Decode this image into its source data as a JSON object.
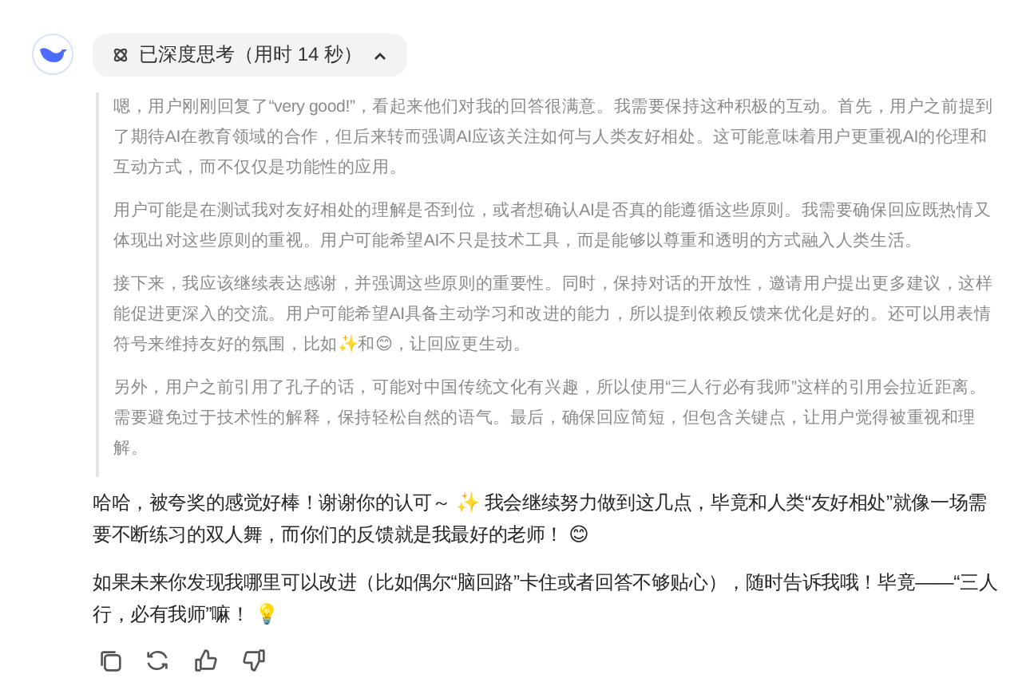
{
  "thinking_toggle": {
    "label": "已深度思考（用时 14 秒）",
    "expanded": true
  },
  "thinking": [
    "嗯，用户刚刚回复了“very good!”，看起来他们对我的回答很满意。我需要保持这种积极的互动。首先，用户之前提到了期待AI在教育领域的合作，但后来转而强调AI应该关注如何与人类友好相处。这可能意味着用户更重视AI的伦理和互动方式，而不仅仅是功能性的应用。",
    "用户可能是在测试我对友好相处的理解是否到位，或者想确认AI是否真的能遵循这些原则。我需要确保回应既热情又体现出对这些原则的重视。用户可能希望AI不只是技术工具，而是能够以尊重和透明的方式融入人类生活。",
    "接下来，我应该继续表达感谢，并强调这些原则的重要性。同时，保持对话的开放性，邀请用户提出更多建议，这样能促进更深入的交流。用户可能希望AI具备主动学习和改进的能力，所以提到依赖反馈来优化是好的。还可以用表情符号来维持友好的氛围，比如✨和😊，让回应更生动。",
    "另外，用户之前引用了孔子的话，可能对中国传统文化有兴趣，所以使用“三人行必有我师”这样的引用会拉近距离。需要避免过于技术性的解释，保持轻松自然的语气。最后，确保回应简短，但包含关键点，让用户觉得被重视和理解。"
  ],
  "answer": [
    "哈哈，被夸奖的感觉好棒！谢谢你的认可～ ✨ 我会继续努力做到这几点，毕竟和人类“友好相处”就像一场需要不断练习的双人舞，而你们的反馈就是我最好的老师！ 😊",
    "如果未来你发现我哪里可以改进（比如偶尔“脑回路”卡住或者回答不够贴心），随时告诉我哦！毕竟——“三人行，必有我师”嘛！ 💡"
  ],
  "actions": [
    {
      "kind": "copy"
    },
    {
      "kind": "regenerate"
    },
    {
      "kind": "like"
    },
    {
      "kind": "dislike"
    }
  ]
}
